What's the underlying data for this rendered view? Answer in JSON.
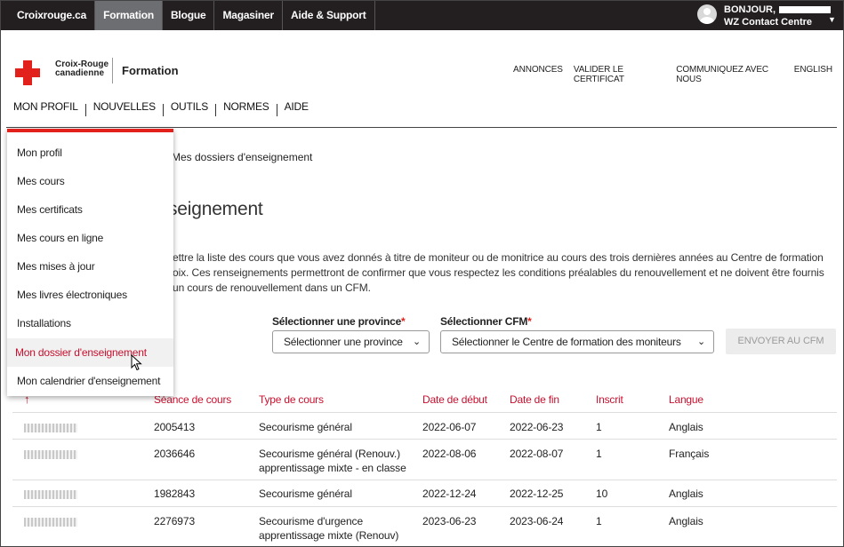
{
  "topbar": {
    "items": [
      {
        "label": "Croixrouge.ca"
      },
      {
        "label": "Formation"
      },
      {
        "label": "Blogue"
      },
      {
        "label": "Magasiner"
      },
      {
        "label": "Aide & Support"
      }
    ],
    "user_greeting": "BONJOUR,",
    "user_org": "WZ Contact Centre"
  },
  "header": {
    "org_line1": "Croix-Rouge",
    "org_line2": "canadienne",
    "site_name": "Formation",
    "utility_links": [
      "ANNONCES",
      "VALIDER LE CERTIFICAT",
      "COMMUNIQUEZ AVEC NOUS",
      "ENGLISH"
    ],
    "nav": [
      "MON PROFIL",
      "NOUVELLES",
      "OUTILS",
      "NORMES",
      "AIDE"
    ]
  },
  "dropdown": {
    "items": [
      "Mon profil",
      "Mes cours",
      "Mes certificats",
      "Mes cours en ligne",
      "Mes mises à jour",
      "Mes livres électroniques",
      "Installations",
      "Mon dossier d'enseignement",
      "Mon calendrier d'enseignement"
    ]
  },
  "content": {
    "breadcrumb": "Mes dossiers d'enseignement",
    "title": "seignement",
    "intro_lines": [
      "ettre la liste des cours que vous avez donnés à titre de moniteur ou de monitrice au cours des trois dernières années au Centre de formation",
      "oix. Ces renseignements permettront de confirmer que vous respectez les conditions préalables du renouvellement et ne doivent être fournis",
      "un cours de renouvellement dans un CFM."
    ],
    "province_label": "Sélectionner une province",
    "province_value": "Sélectionner une province",
    "cfm_label": "Sélectionner CFM",
    "cfm_value": "Sélectionner le Centre de formation des moniteurs",
    "required_mark": "*",
    "send_button": "ENVOYER AU CFM"
  },
  "table": {
    "headers": [
      "Séance de cours",
      "Type de cours",
      "Date de début",
      "Date de fin",
      "Inscrit",
      "Langue"
    ],
    "rows": [
      {
        "id": "",
        "seance": "2005413",
        "type1": "Secourisme général",
        "type2": "",
        "debut": "2022-06-07",
        "fin": "2022-06-23",
        "inscrit": "1",
        "langue": "Anglais"
      },
      {
        "id": "",
        "seance": "2036646",
        "type1": "Secourisme général (Renouv.)",
        "type2": "apprentissage mixte - en classe",
        "debut": "2022-08-06",
        "fin": "2022-08-07",
        "inscrit": "1",
        "langue": "Français"
      },
      {
        "id": "",
        "seance": "1982843",
        "type1": "Secourisme général",
        "type2": "",
        "debut": "2022-12-24",
        "fin": "2022-12-25",
        "inscrit": "10",
        "langue": "Anglais"
      },
      {
        "id": "",
        "seance": "2276973",
        "type1": "Secourisme d'urgence",
        "type2": "apprentissage mixte (Renouv)",
        "debut": "2023-06-23",
        "fin": "2023-06-24",
        "inscrit": "1",
        "langue": "Anglais"
      }
    ]
  },
  "colors": {
    "accent_red": "#e2211c",
    "header_red": "#c8102e",
    "topbar_bg": "#231f20"
  }
}
